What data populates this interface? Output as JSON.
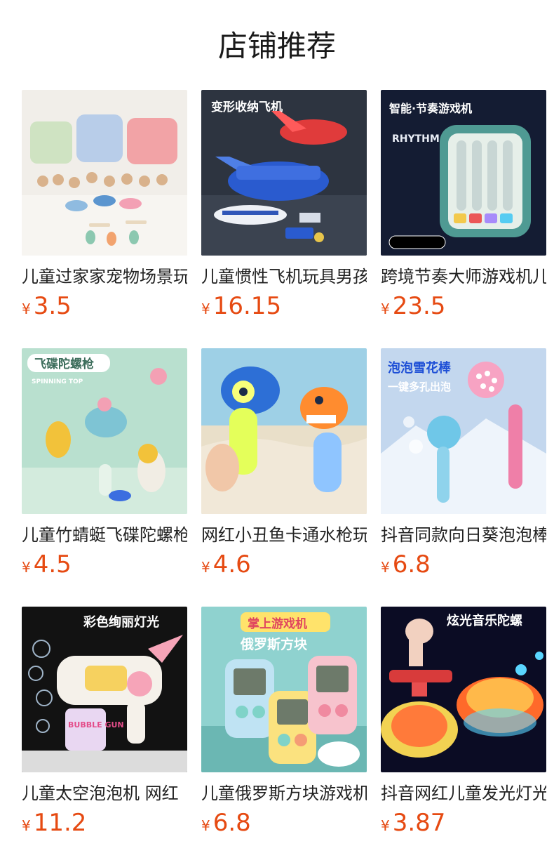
{
  "page": {
    "title": "店铺推荐"
  },
  "products": [
    {
      "name": "儿童过家家宠物场景玩具",
      "currency": "¥",
      "price": "3.5",
      "image_theme": "pet-carrier-playset",
      "image_text": "",
      "image_subtext": ""
    },
    {
      "name": "儿童惯性飞机玩具男孩",
      "currency": "¥",
      "price": "16.15",
      "image_theme": "storage-airplane",
      "image_text": "变形收纳飞机",
      "image_subtext": ""
    },
    {
      "name": "跨境节奏大师游戏机儿童",
      "currency": "¥",
      "price": "23.5",
      "image_theme": "rhythm-game-machine",
      "image_text": "智能·节奏游戏机",
      "image_subtext": "RHYTHM"
    },
    {
      "name": "儿童竹蜻蜓飞碟陀螺枪",
      "currency": "¥",
      "price": "4.5",
      "image_theme": "flying-disc-gun",
      "image_text": "飞碟陀螺枪",
      "image_subtext": "SPINNING TOP"
    },
    {
      "name": "网红小丑鱼卡通水枪玩具",
      "currency": "¥",
      "price": "4.6",
      "image_theme": "clownfish-water-gun",
      "image_text": "",
      "image_subtext": ""
    },
    {
      "name": "抖音同款向日葵泡泡棒",
      "currency": "¥",
      "price": "6.8",
      "image_theme": "bubble-wand",
      "image_text": "泡泡雪花棒",
      "image_subtext": "一键多孔出泡"
    },
    {
      "name": "儿童太空泡泡机 网红",
      "currency": "¥",
      "price": "11.2",
      "image_theme": "bubble-gun",
      "image_text": "彩色绚丽灯光",
      "image_subtext": "BUBBLE GUN"
    },
    {
      "name": "儿童俄罗斯方块游戏机",
      "currency": "¥",
      "price": "6.8",
      "image_theme": "handheld-tetris",
      "image_text": "掌上游戏机",
      "image_subtext": "俄罗斯方块"
    },
    {
      "name": "抖音网红儿童发光灯光陀螺",
      "currency": "¥",
      "price": "3.87",
      "image_theme": "light-music-top",
      "image_text": "炫光音乐陀螺",
      "image_subtext": ""
    }
  ],
  "colors": {
    "price": "#e64a12",
    "text": "#222222",
    "title": "#1a1a1a"
  }
}
